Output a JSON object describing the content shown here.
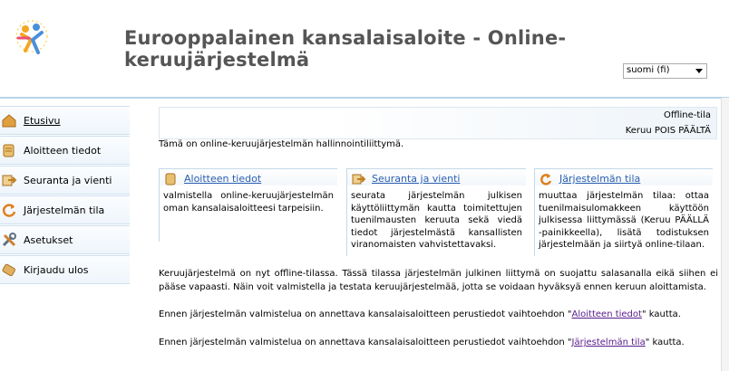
{
  "header": {
    "title": "Eurooppalainen kansalaisaloite - Online-keruujärjestelmä",
    "language_selected": "suomi (fi)"
  },
  "sidebar": {
    "items": [
      {
        "label": "Etusivu",
        "icon": "home-icon"
      },
      {
        "label": "Aloitteen tiedot",
        "icon": "scroll-icon"
      },
      {
        "label": "Seuranta ja vienti",
        "icon": "export-arrow-icon"
      },
      {
        "label": "Järjestelmän tila",
        "icon": "refresh-icon"
      },
      {
        "label": "Asetukset",
        "icon": "tools-icon"
      },
      {
        "label": "Kirjaudu ulos",
        "icon": "logout-icon"
      }
    ]
  },
  "status": {
    "mode": "Offline-tila",
    "collection": "Keruu POIS PÄÄLTÄ"
  },
  "intro": "Tämä on online-keruujärjestelmän hallinnointiliittymä.",
  "cards": [
    {
      "title": "Aloitteen tiedot",
      "text": "valmistella online-keruujärjestelmän oman kansalaisaloitteesi tarpeisiin."
    },
    {
      "title": "Seuranta ja vienti",
      "text": "seurata järjestelmän julkisen käyttöliittymän kautta toimitettujen tuenilmausten keruuta sekä viedä tiedot järjestelmästä kansallisten viranomaisten vahvistettavaksi."
    },
    {
      "title": "Järjestelmän tila",
      "text": "muuttaa järjestelmän tilaa: ottaa tuenilmaisulomakkeen käyttöön julkisessa liittymässä (Keruu PÄÄLLÄ -painikkeella), lisätä todistuksen järjestelmään ja siirtyä online-tilaan."
    }
  ],
  "paragraphs": {
    "offline_notice": "Keruujärjestelmä on nyt offline-tilassa. Tässä tilassa järjestelmän julkinen liittymä on suojattu salasanalla eikä siihen ei pääse vapaasti. Näin voit valmistella ja testata keruujärjestelmää, jotta se voidaan hyväksyä ennen keruun aloittamista.",
    "prep1_before": "Ennen järjestelmän valmistelua on annettava kansalaisaloitteen perustiedot vaihtoehdon \"",
    "prep1_link": "Aloitteen tiedot",
    "prep1_after": "\" kautta.",
    "prep2_before": "Ennen järjestelmän valmistelua on annettava kansalaisaloitteen perustiedot vaihtoehdon \"",
    "prep2_link": "Järjestelmän tila",
    "prep2_after": "\" kautta."
  },
  "colors": {
    "accent_blue": "#2a5fb0",
    "border_blue": "#b7d4ea",
    "title_gray": "#555555"
  }
}
